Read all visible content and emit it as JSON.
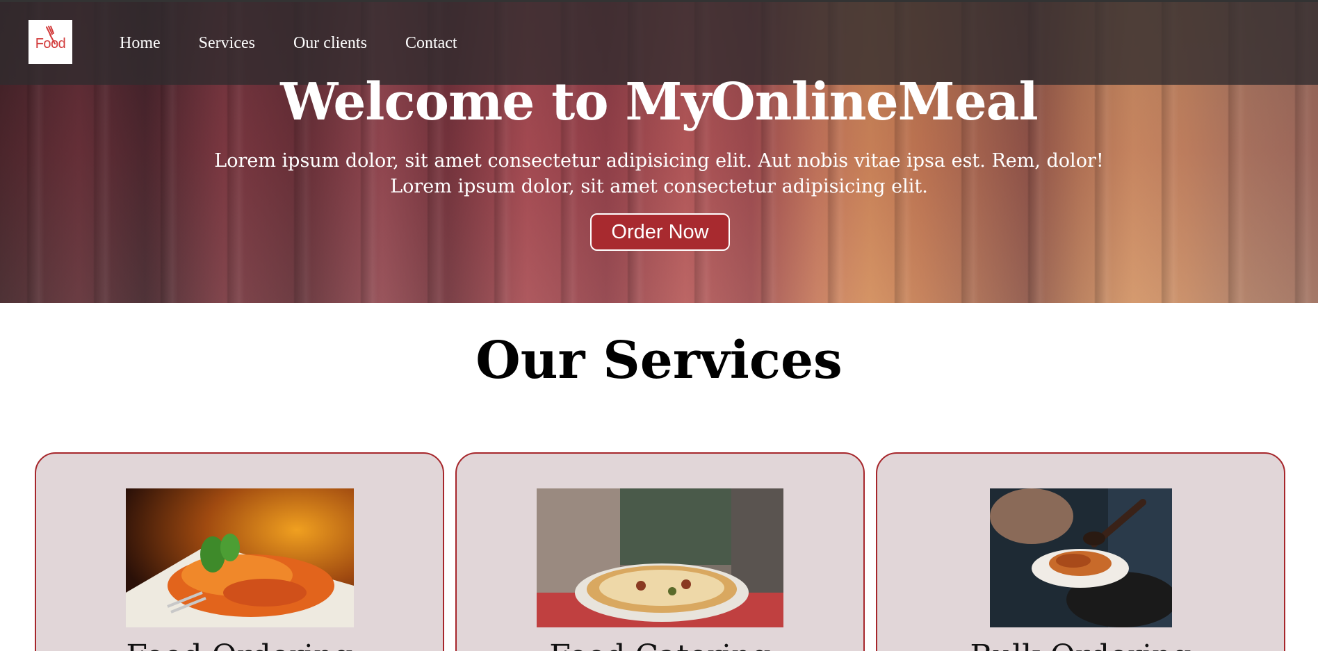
{
  "nav": {
    "logo_text": "Food",
    "links": [
      "Home",
      "Services",
      "Our clients",
      "Contact"
    ]
  },
  "hero": {
    "title": "Welcome to MyOnlineMeal",
    "subtitle_line1": "Lorem ipsum dolor, sit amet consectetur adipisicing elit. Aut nobis vitae ipsa est. Rem, dolor!",
    "subtitle_line2": "Lorem ipsum dolor, sit amet consectetur adipisicing elit.",
    "cta_label": "Order Now"
  },
  "services": {
    "title": "Our Services",
    "cards": [
      {
        "title": "Food Ordering",
        "image": "pasta-photo"
      },
      {
        "title": "Food Catering",
        "image": "pizza-photo"
      },
      {
        "title": "Bulk Ordering",
        "image": "plated-dish-photo"
      }
    ]
  },
  "colors": {
    "accent": "#a82a2f",
    "card_bg": "#e1d6d8",
    "nav_bg": "#302c2e"
  }
}
